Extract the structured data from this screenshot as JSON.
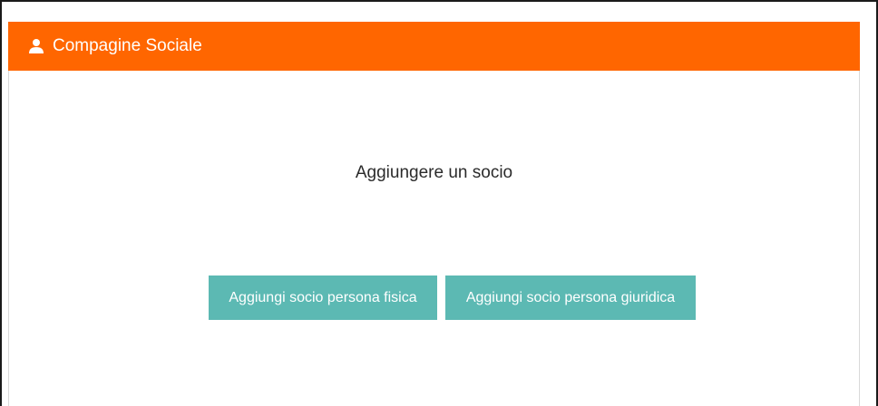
{
  "header": {
    "icon": "user-icon",
    "title": "Compagine Sociale",
    "color": "#ff6600"
  },
  "body": {
    "prompt": "Aggiungere un socio",
    "buttons": {
      "fisica_label": "Aggiungi socio persona fisica",
      "giuridica_label": "Aggiungi socio persona giuridica",
      "color": "#5cb9b3"
    }
  }
}
